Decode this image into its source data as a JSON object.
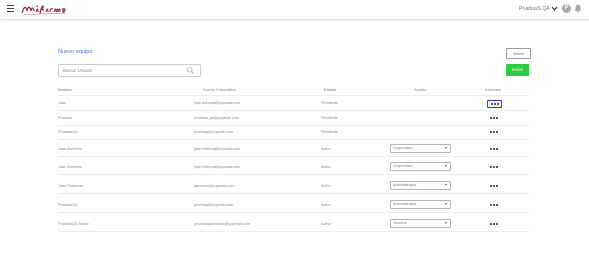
{
  "header": {
    "logo_text": "mifirma",
    "user_name": "PruebasS QA",
    "user_initial": "P",
    "icons": [
      "menu-icon",
      "chevron-down-icon",
      "user-icon",
      "bell-icon"
    ]
  },
  "page": {
    "title": "Nuevo equipo",
    "back_label": "Volver",
    "search_placeholder": "Buscar Usuario",
    "invite_label": "Invitar",
    "accent_color": "#2ecc40"
  },
  "table": {
    "headers": {
      "name": "Nombre",
      "email": "Correo Corporativo",
      "status": "Estado",
      "access": "Acceso",
      "actions": "Acciones"
    },
    "rows": [
      {
        "name": "Juan",
        "email": "juan.dohmia@yopmail.com",
        "status": "Pendiente",
        "access": ""
      },
      {
        "name": "Pruebas",
        "email": "pruebas_qa@yopmail.com",
        "status": "Pendiente",
        "access": ""
      },
      {
        "name": "PruebasQA",
        "email": "pruebqa@yopmail.com",
        "status": "Pendiente",
        "access": ""
      },
      {
        "name": "Juan Acevedo",
        "email": "juan.mifirma@yopmail.com",
        "status": "Activo",
        "access": "Corporativo"
      },
      {
        "name": "Juan Acevedo",
        "email": "juan.mifirma@yopmail.com",
        "status": "Activo",
        "access": "Corporativo"
      },
      {
        "name": "Juan Pertomar",
        "email": "jatchoma@yopmail.com",
        "status": "Activo",
        "access": "Administrador"
      },
      {
        "name": "PruebasQA",
        "email": "pruebqa@yopmail.com",
        "status": "Activo",
        "access": "Administrador"
      },
      {
        "name": "PruebasQA Tester",
        "email": "pruebasqamirmaa@yopmail.com",
        "status": "Activo",
        "access": "General"
      }
    ]
  }
}
